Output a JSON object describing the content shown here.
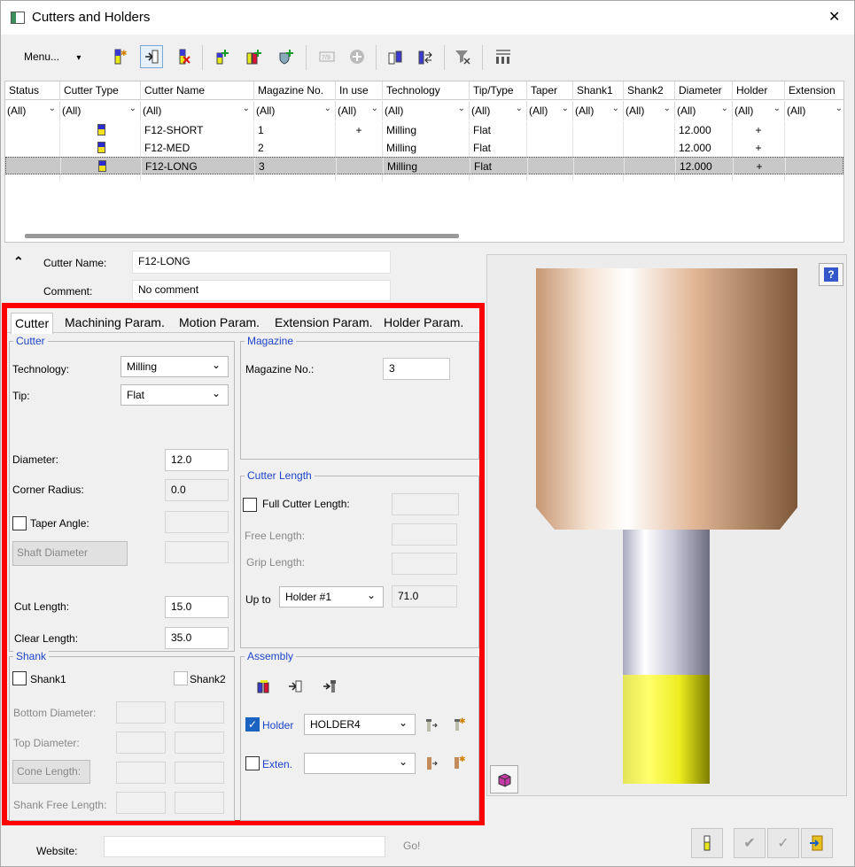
{
  "window": {
    "title": "Cutters and Holders",
    "close_glyph": "✕"
  },
  "toolbar": {
    "menu_label": "Menu...",
    "menu_arrow": "▾"
  },
  "grid": {
    "columns": [
      "Status",
      "Cutter Type",
      "Cutter Name",
      "Magazine No.",
      "In use",
      "Technology",
      "Tip/Type",
      "Taper",
      "Shank1",
      "Shank2",
      "Diameter",
      "Holder",
      "Extension"
    ],
    "filter_value": "(All)",
    "rows": [
      {
        "name": "F12-SHORT",
        "magazine": "1",
        "in_use": "+",
        "technology": "Milling",
        "tip": "Flat",
        "diameter": "12.000",
        "holder": "+"
      },
      {
        "name": "F12-MED",
        "magazine": "2",
        "in_use": "",
        "technology": "Milling",
        "tip": "Flat",
        "diameter": "12.000",
        "holder": "+"
      },
      {
        "name": "F12-LONG",
        "magazine": "3",
        "in_use": "",
        "technology": "Milling",
        "tip": "Flat",
        "diameter": "12.000",
        "holder": "+"
      }
    ]
  },
  "detail": {
    "cutter_name_label": "Cutter Name:",
    "cutter_name_value": "F12-LONG",
    "comment_label": "Comment:",
    "comment_value": "No comment",
    "collapse_glyph": "⌃"
  },
  "tabs": [
    "Cutter",
    "Machining Param.",
    "Motion Param.",
    "Extension Param.",
    "Holder Param."
  ],
  "cutter_group": {
    "caption": "Cutter",
    "technology_label": "Technology:",
    "technology_value": "Milling",
    "tip_label": "Tip:",
    "tip_value": "Flat",
    "diameter_label": "Diameter:",
    "diameter_value": "12.0",
    "corner_radius_label": "Corner Radius:",
    "corner_radius_value": "0.0",
    "taper_angle_label": "Taper Angle:",
    "shaft_diameter_label": "Shaft Diameter",
    "cut_length_label": "Cut Length:",
    "cut_length_value": "15.0",
    "clear_length_label": "Clear Length:",
    "clear_length_value": "35.0"
  },
  "magazine_group": {
    "caption": "Magazine",
    "magazine_no_label": "Magazine No.:",
    "magazine_no_value": "3"
  },
  "cutter_length_group": {
    "caption": "Cutter Length",
    "full_label": "Full Cutter Length:",
    "free_label": "Free Length:",
    "grip_label": "Grip Length:",
    "upto_label": "Up to",
    "upto_value": "Holder #1",
    "upto_length": "71.0"
  },
  "shank_group": {
    "caption": "Shank",
    "shank1_label": "Shank1",
    "shank2_label": "Shank2",
    "bottom_label": "Bottom Diameter:",
    "top_label": "Top Diameter:",
    "cone_label": "Cone Length:",
    "free_label": "Shank Free Length:"
  },
  "assembly_group": {
    "caption": "Assembly",
    "holder_label": "Holder",
    "holder_value": "HOLDER4",
    "holder_checked": true,
    "exten_label": "Exten.",
    "exten_value": ""
  },
  "footer": {
    "website_label": "Website:",
    "website_value": "",
    "go_label": "Go!"
  },
  "colors": {
    "highlight": "#ff0000",
    "link_blue": "#1d44c9",
    "tool_yellow": "#e8e81a",
    "holder_copper": "#d9ad8b"
  }
}
